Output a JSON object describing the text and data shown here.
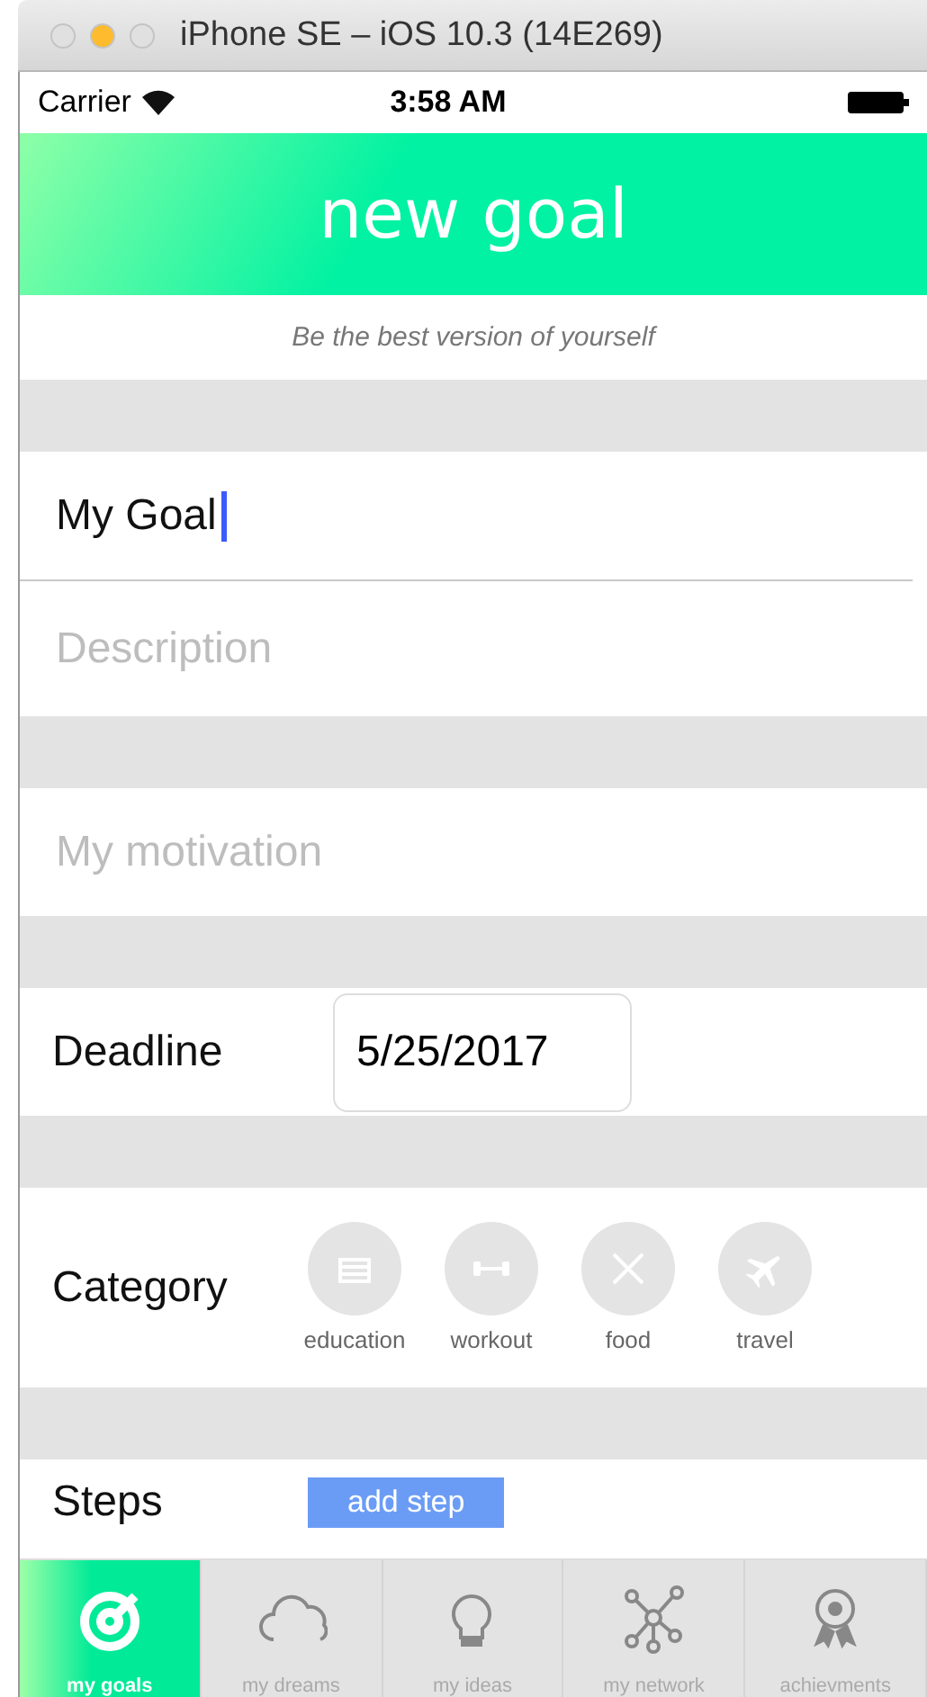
{
  "window": {
    "title": "iPhone SE – iOS 10.3 (14E269)"
  },
  "status_bar": {
    "carrier": "Carrier",
    "time": "3:58 AM"
  },
  "header": {
    "title": "new goal",
    "tagline": "Be the best version of yourself"
  },
  "goal": {
    "value": "My Goal"
  },
  "description": {
    "placeholder": "Description"
  },
  "motivation": {
    "placeholder": "My motivation"
  },
  "deadline": {
    "label": "Deadline",
    "value": "5/25/2017"
  },
  "category": {
    "label": "Category",
    "items": [
      {
        "kind": "education",
        "label": "education",
        "selected": false
      },
      {
        "kind": "workout",
        "label": "workout",
        "selected": false
      },
      {
        "kind": "food",
        "label": "food",
        "selected": false
      },
      {
        "kind": "travel",
        "label": "travel",
        "selected": false
      }
    ]
  },
  "steps": {
    "label": "Steps",
    "button": "add step"
  },
  "tabs": [
    {
      "kind": "goals",
      "label": "my goals",
      "selected": true
    },
    {
      "kind": "dreams",
      "label": "my dreams",
      "selected": false
    },
    {
      "kind": "ideas",
      "label": "my ideas",
      "selected": false
    },
    {
      "kind": "network",
      "label": "my network",
      "selected": false
    },
    {
      "kind": "achievements",
      "label": "achievments",
      "selected": false
    }
  ]
}
